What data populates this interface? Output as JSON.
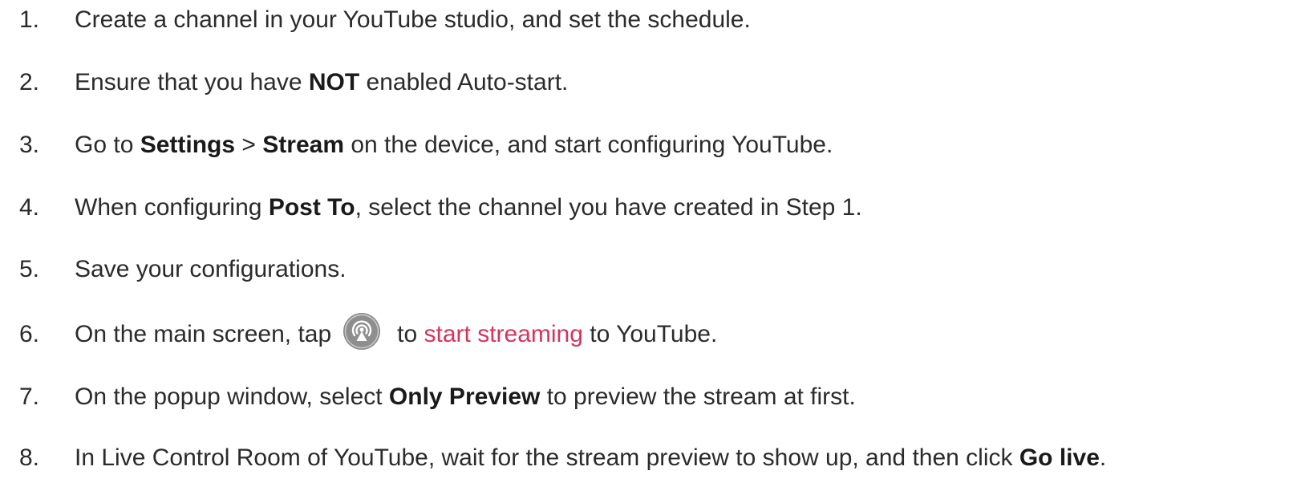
{
  "steps": [
    {
      "num": "1.",
      "parts": [
        "Create a channel in your YouTube studio, and set the schedule."
      ]
    },
    {
      "num": "2.",
      "parts": [
        "Ensure that you have ",
        "NOT",
        " enabled Auto-start."
      ]
    },
    {
      "num": "3.",
      "parts": [
        "Go to ",
        "Settings",
        " > ",
        "Stream",
        " on the device, and start configuring YouTube."
      ]
    },
    {
      "num": "4.",
      "parts": [
        "When configuring ",
        "Post To",
        ", select the channel you have created in Step 1."
      ]
    },
    {
      "num": "5.",
      "parts": [
        "Save your configurations."
      ]
    },
    {
      "num": "6.",
      "parts": [
        "On the main screen, tap",
        "to ",
        "start streaming",
        " to YouTube."
      ]
    },
    {
      "num": "7.",
      "parts": [
        "On the popup window, select ",
        "Only Preview",
        " to preview the stream at first."
      ]
    },
    {
      "num": "8.",
      "parts": [
        "In Live Control Room of YouTube, wait for the stream preview to show up, and then click ",
        "Go live",
        "."
      ]
    }
  ],
  "icons": {
    "step6": "live-stream-icon"
  },
  "colors": {
    "text": "#2b2b2b",
    "link": "#d6345c",
    "icon_bg": "#8e8e8e"
  }
}
